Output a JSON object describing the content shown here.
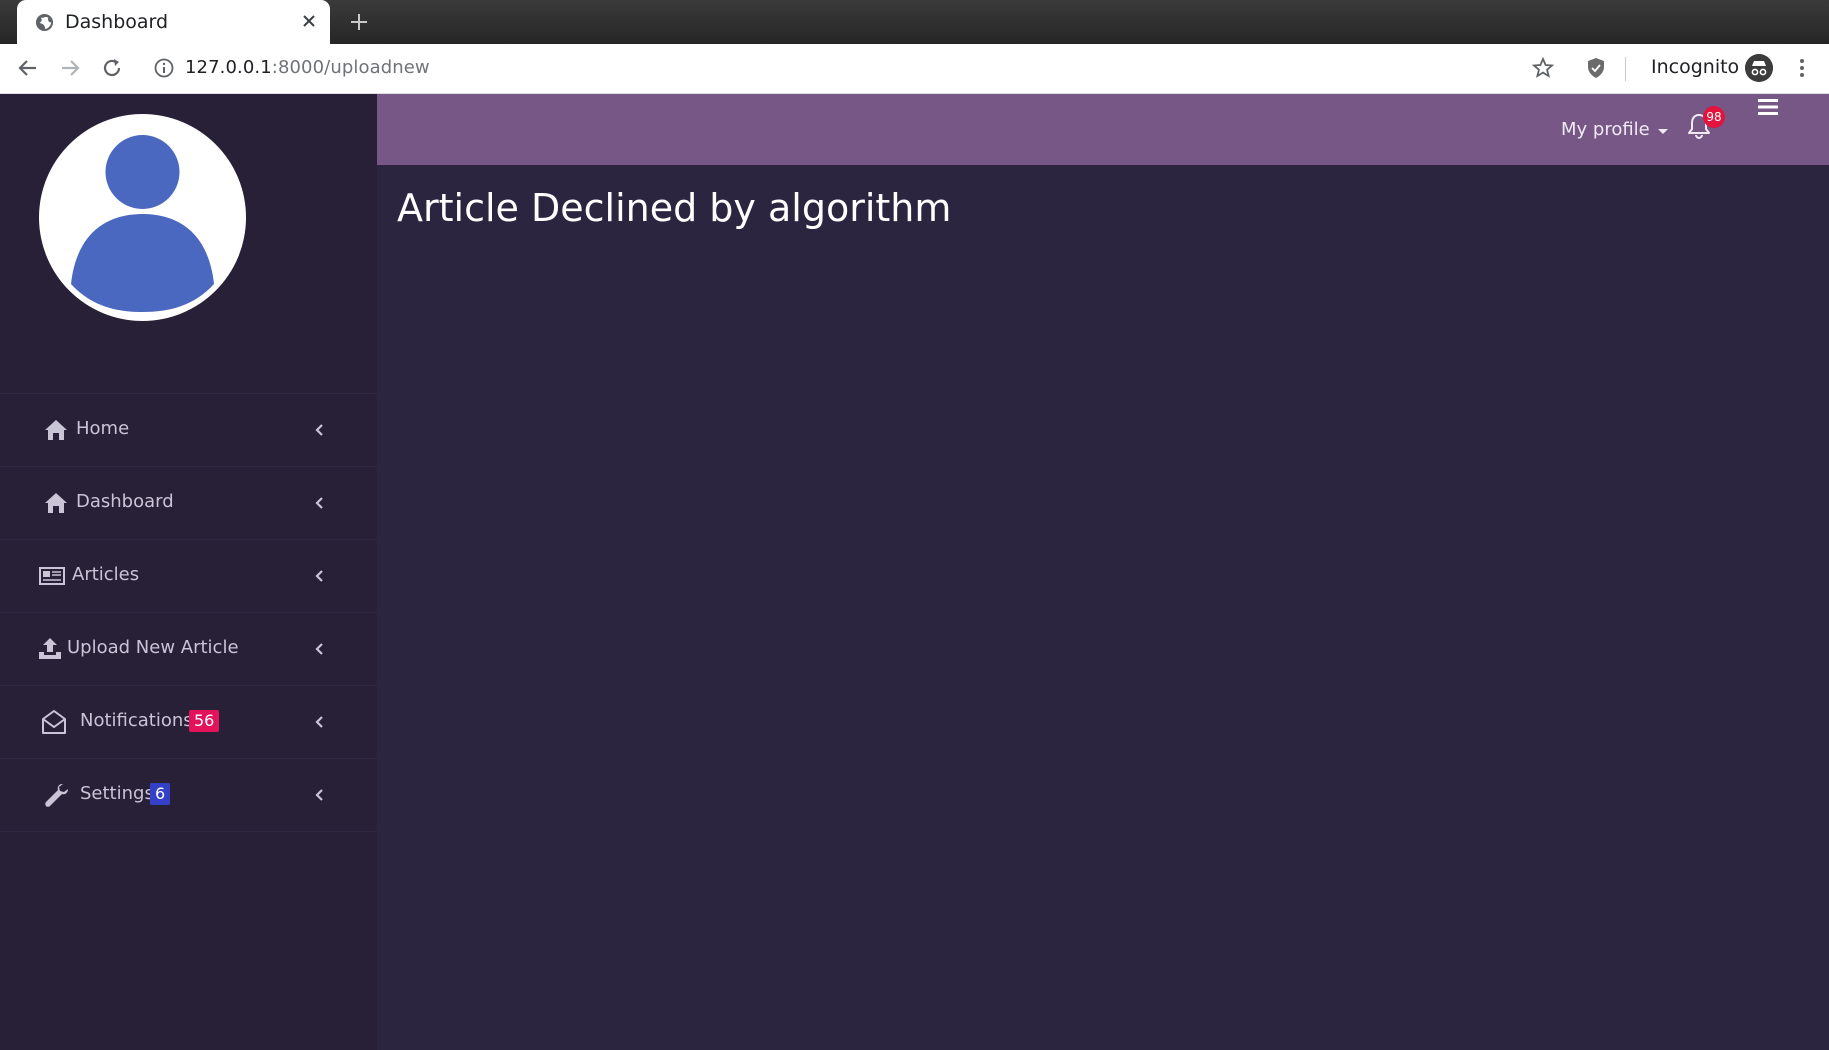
{
  "browser": {
    "tab_title": "Dashboard",
    "url_host": "127.0.0.1",
    "url_path": ":8000/uploadnew",
    "incognito_label": "Incognito"
  },
  "topbar": {
    "profile_label": "My profile",
    "notification_count": "98",
    "color": "#765785"
  },
  "sidebar": {
    "color": "#272036",
    "items": [
      {
        "label": "Home",
        "icon": "home-icon"
      },
      {
        "label": "Dashboard",
        "icon": "home-icon"
      },
      {
        "label": "Articles",
        "icon": "newspaper-icon"
      },
      {
        "label": "Upload New Article",
        "icon": "upload-icon"
      },
      {
        "label": "Notifications",
        "icon": "envelope-open-icon",
        "badge": "56",
        "badge_color": "#e2135b"
      },
      {
        "label": "Settings",
        "icon": "wrench-icon",
        "badge": "6",
        "badge_color": "#3440c8"
      }
    ]
  },
  "main": {
    "title": "Article Declined by algorithm"
  }
}
